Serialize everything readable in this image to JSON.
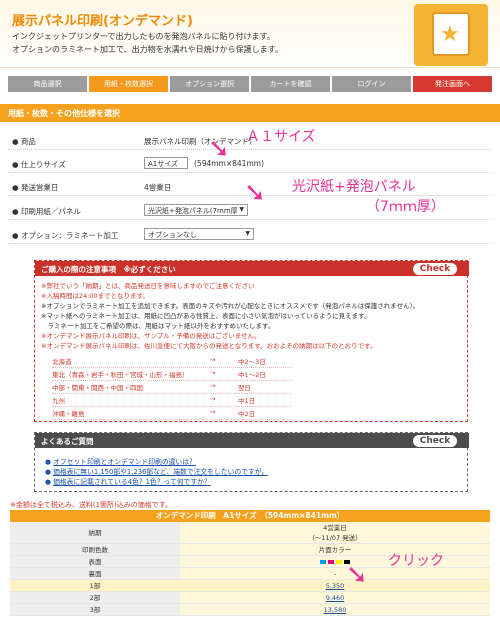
{
  "header": {
    "title": "展示パネル印刷(オンデマンド)",
    "desc1": "インクジェットプリンターで出力したものを発泡パネルに貼り付けます。",
    "desc2": "オプションのラミネート加工で、出力物を水濡れや日焼けから保護します。"
  },
  "steps": [
    "商品選択",
    "用紙・枚数選択",
    "オプション選択",
    "カートを確認",
    "ログイン",
    "発注画面へ"
  ],
  "section_title": "用紙・枚数・その他仕様を選択",
  "form": {
    "product_label": "商品",
    "product_value": "展示パネル印刷（オンデマンド）",
    "size_label": "仕上りサイズ",
    "size_value": "A1サイズ",
    "size_dims": "(594mm×841mm)",
    "ship_label": "発送営業日",
    "ship_value": "4営業日",
    "paper_label": "印刷用紙／パネル",
    "paper_value": "光沢紙+発泡パネル(7mm厚",
    "option_label": "オプション：ラミネート加工",
    "option_value": "オプションなし"
  },
  "annotations": {
    "a1": "Ａ１サイズ",
    "panel1": "光沢紙+発泡パネル",
    "panel2": "（7ｍｍ厚）",
    "click": "クリック"
  },
  "notice": {
    "title": "ご購入の際の注意事項　※必ずください",
    "check": "Check",
    "lines": [
      "※弊社でいう「納期」とは、商品発送日を意味しますのでご注意ください",
      "※入稿時間は24:00までとなります。",
      "※オプションでラミネート加工を追加できます。表面のキズや汚れが心配なときにオススメです（発泡パネルは保護されません）。",
      "※マット紙へのラミネート加工は、用紙に凹凸がある性質上、表面に小さい気泡がはいっているように見えます。",
      "　ラミネート加工をご希望の際は、用紙はマット紙以外をおすすめいたします。",
      "※オンデマンド展示パネル印刷は、サンプル・予備の発送はございません。",
      "※オンデマンド展示パネル印刷は、佐川急便にて大阪からの発送となります。おおよその納期は以下のとおりです。"
    ],
    "regions": [
      {
        "name": "北海道",
        "days": "中2〜3日"
      },
      {
        "name": "東北（青森・岩手・秋田・宮城・山形・福島）",
        "days": "中1〜2日"
      },
      {
        "name": "中部・関東・関西・中国・四国",
        "days": "翌日"
      },
      {
        "name": "九州",
        "days": "中1日"
      },
      {
        "name": "沖縄・離島",
        "days": "中2日"
      }
    ],
    "arrow": "→"
  },
  "faq": {
    "title": "よくあるご質問",
    "check": "Check",
    "items": [
      "オフセット印刷とオンデマンド印刷の違いは？",
      "価格表に無い1,150部や1,236部など、端数で注文をしたいのですが。",
      "価格表に記載されている4色？1色？って何ですか？"
    ]
  },
  "price": {
    "note": "※金額は全て税込み、送料(1箇所)込みの価格です。",
    "header": "オンデマンド印刷　A1サイズ　（594mm×841mm）",
    "rows": [
      {
        "label": "納期",
        "value": "4営業日",
        "sub": "（〜11/07 発送）"
      },
      {
        "label": "印刷色数",
        "value": "片面カラー"
      },
      {
        "label": "表面",
        "value": ""
      },
      {
        "label": "裏面",
        "value": "-"
      },
      {
        "label": "1部",
        "value": "5,350"
      },
      {
        "label": "2部",
        "value": "9,460"
      },
      {
        "label": "3部",
        "value": "13,580"
      }
    ],
    "swatch_colors": [
      "#00a0e9",
      "#e4007f",
      "#fff100",
      "#000000"
    ]
  }
}
